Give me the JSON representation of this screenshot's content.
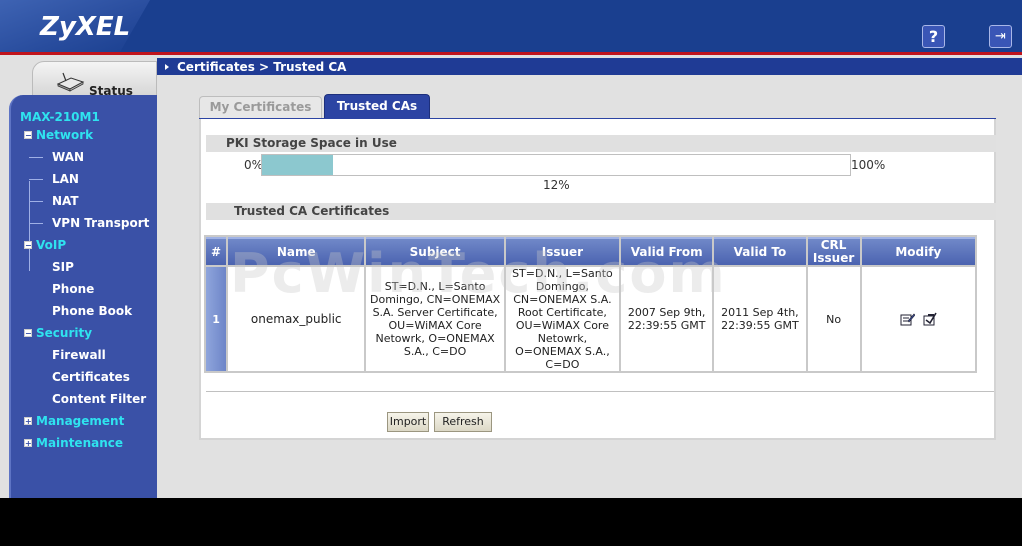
{
  "app": {
    "logo": "ZyXEL"
  },
  "header": {
    "help_icon_text": "?",
    "logout_icon_text": "⇥"
  },
  "sidebar": {
    "status_label": "Status",
    "device": "MAX-210M1",
    "groups": [
      {
        "label": "Network",
        "toggle": "−",
        "items": [
          "WAN",
          "LAN",
          "NAT",
          "VPN Transport"
        ]
      },
      {
        "label": "VoIP",
        "toggle": "−",
        "items": [
          "SIP",
          "Phone",
          "Phone Book"
        ]
      },
      {
        "label": "Security",
        "toggle": "−",
        "items": [
          "Firewall",
          "Certificates",
          "Content Filter"
        ]
      },
      {
        "label": "Management",
        "toggle": "+",
        "items": []
      },
      {
        "label": "Maintenance",
        "toggle": "+",
        "items": []
      }
    ]
  },
  "breadcrumb": "Certificates > Trusted CA",
  "tabs": [
    {
      "label": "My Certificates",
      "active": false
    },
    {
      "label": "Trusted CAs",
      "active": true
    }
  ],
  "storage": {
    "title": "PKI Storage Space in Use",
    "min_label": "0%",
    "max_label": "100%",
    "value_label": "12%",
    "value": 0.12
  },
  "ca_section_title": "Trusted CA Certificates",
  "table": {
    "headers": [
      "#",
      "Name",
      "Subject",
      "Issuer",
      "Valid From",
      "Valid To",
      "CRL Issuer",
      "Modify"
    ],
    "rows": [
      {
        "index": "1",
        "name": "onemax_public",
        "subject": "ST=D.N., L=Santo Domingo, CN=ONEMAX S.A. Server Certificate, OU=WiMAX Core Netowrk, O=ONEMAX S.A., C=DO",
        "issuer": "ST=D.N., L=Santo Domingo, CN=ONEMAX S.A. Root Certificate, OU=WiMAX Core Netowrk, O=ONEMAX S.A., C=DO",
        "valid_from": "2007 Sep 9th, 22:39:55 GMT",
        "valid_to": "2011 Sep 4th, 22:39:55 GMT",
        "crl_issuer": "No"
      }
    ]
  },
  "buttons": {
    "import": "Import",
    "refresh": "Refresh"
  },
  "watermark": "PcWinTech.com",
  "colors": {
    "nav_bg": "#3a51a7",
    "nav_group": "#2fe3ef",
    "header_bg": "#1a3f8f",
    "accent_red": "#c0141c",
    "bar_fill": "#8cc8cf"
  }
}
